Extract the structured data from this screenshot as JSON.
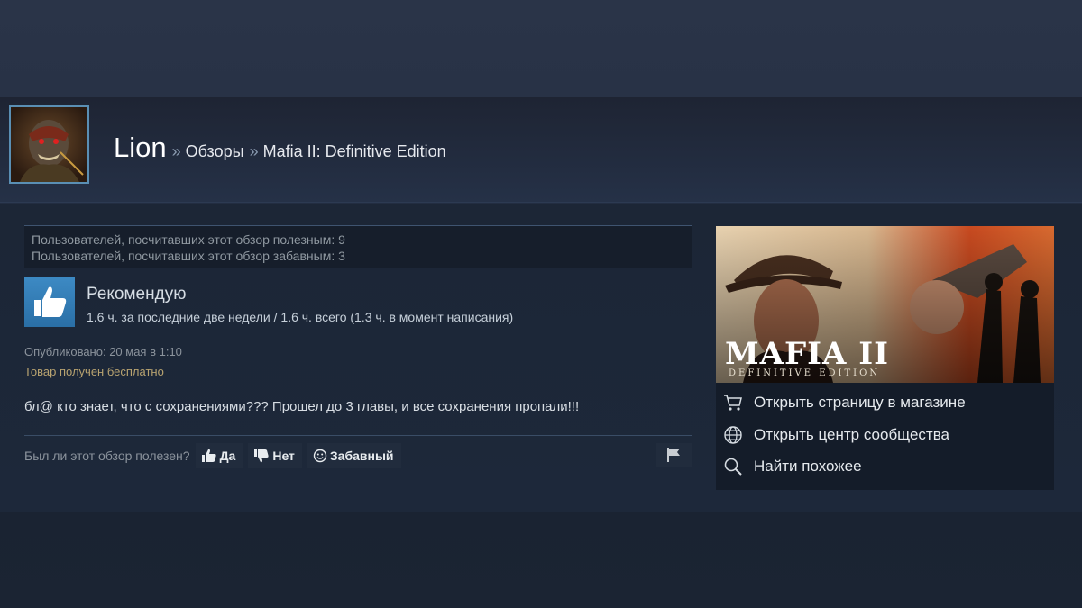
{
  "header": {
    "username": "Lion",
    "sep1": "»",
    "crumb_reviews": "Обзоры",
    "sep2": "»",
    "crumb_game": "Mafia II: Definitive Edition"
  },
  "review": {
    "helpful_line": "Пользователей, посчитавших этот обзор полезным: 9",
    "funny_line": "Пользователей, посчитавших этот обзор забавным: 3",
    "verdict": "Рекомендую",
    "hours": "1.6 ч. за последние две недели / 1.6 ч. всего (1.3 ч. в момент написания)",
    "posted": "Опубликовано: 20 мая в 1:10",
    "received": "Товар получен бесплатно",
    "text": "бл@ кто знает, что с сохранениями??? Прошел до 3 главы, и все сохранения пропали!!!"
  },
  "vote": {
    "question": "Был ли этот обзор полезен?",
    "yes_label": "Да",
    "no_label": "Нет",
    "funny_label": "Забавный"
  },
  "sidebar": {
    "capsule_logo": "MAFIA II",
    "capsule_sub": "DEFINITIVE EDITION",
    "links": [
      {
        "label": "Открыть страницу в магазине",
        "icon": "cart-icon"
      },
      {
        "label": "Открыть центр сообщества",
        "icon": "globe-icon"
      },
      {
        "label": "Найти похожее",
        "icon": "magnifier-icon"
      }
    ]
  },
  "colors": {
    "accent_blue": "#3d8ac4",
    "free_text": "#b8a370",
    "panel_bg": "#141c29"
  }
}
